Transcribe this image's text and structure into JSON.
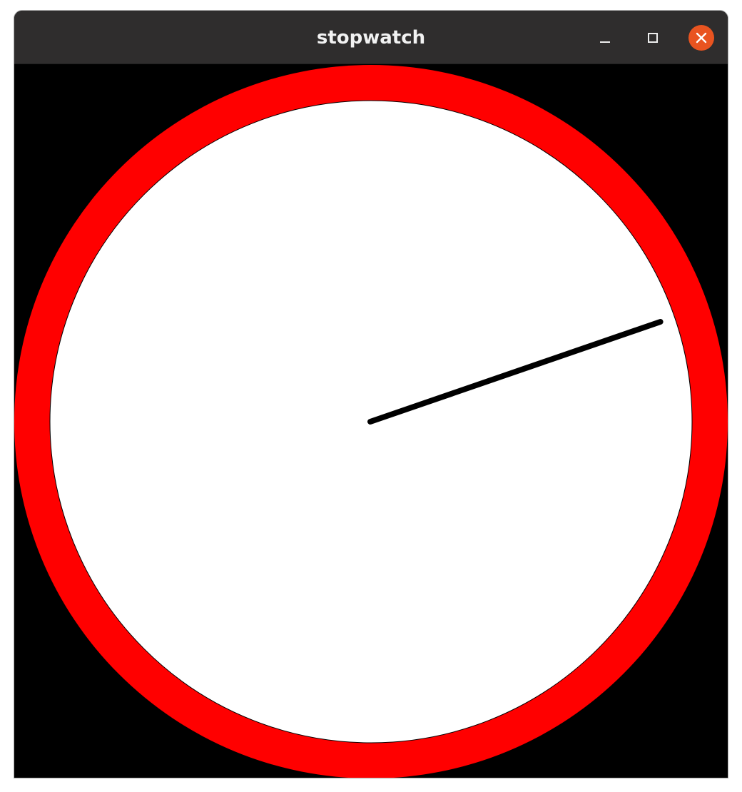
{
  "window": {
    "title": "stopwatch"
  },
  "controls": {
    "minimize_icon": "minimize-icon",
    "maximize_icon": "maximize-icon",
    "close_icon": "close-icon",
    "close_color": "#e95420"
  },
  "stopwatch": {
    "background_color": "#000000",
    "ring_color": "#ff0000",
    "face_color": "#ffffff",
    "hand_color": "#000000",
    "hand_angle_degrees": 71
  }
}
